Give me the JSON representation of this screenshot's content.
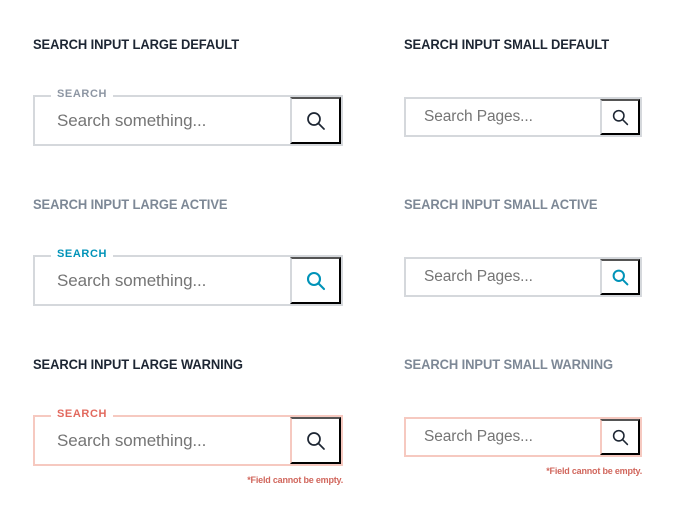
{
  "theme": {
    "background": "#ffffff",
    "heading_color": "#1d2633",
    "heading_muted_color": "#7d8896",
    "border_default": "#d5d8dc",
    "border_warning": "#f6c9c0",
    "placeholder_color": "#c6cad0",
    "accent_active": "#0093b8",
    "accent_warning": "#e2695e",
    "error_text_color": "#d1675d",
    "icon_default_color": "#1d2633"
  },
  "icons": {
    "search": "search-icon"
  },
  "variants": [
    {
      "id": "large-default",
      "heading": "SEARCH INPUT LARGE DEFAULT",
      "heading_style": "dark",
      "size": "large",
      "state": "default",
      "label": "SEARCH",
      "has_label": true,
      "placeholder": "Search something...",
      "value": "",
      "icon": "search-icon",
      "error": "",
      "has_error": false
    },
    {
      "id": "small-default",
      "heading": "SEARCH INPUT SMALL DEFAULT",
      "heading_style": "dark",
      "size": "small",
      "state": "default",
      "label": "",
      "has_label": false,
      "placeholder": "Search Pages...",
      "value": "",
      "icon": "search-icon",
      "error": "",
      "has_error": false
    },
    {
      "id": "large-active",
      "heading": "SEARCH INPUT LARGE ACTIVE",
      "heading_style": "muted",
      "size": "large",
      "state": "active",
      "label": "SEARCH",
      "has_label": true,
      "placeholder": "Search something...",
      "value": "",
      "icon": "search-icon",
      "error": "",
      "has_error": false
    },
    {
      "id": "small-active",
      "heading": "SEARCH INPUT SMALL ACTIVE",
      "heading_style": "muted",
      "size": "small",
      "state": "active",
      "label": "",
      "has_label": false,
      "placeholder": "Search Pages...",
      "value": "",
      "icon": "search-icon",
      "error": "",
      "has_error": false
    },
    {
      "id": "large-warning",
      "heading": "SEARCH INPUT LARGE WARNING",
      "heading_style": "dark",
      "size": "large",
      "state": "warning",
      "label": "SEARCH",
      "has_label": true,
      "placeholder": "Search something...",
      "value": "",
      "icon": "search-icon",
      "error": "*Field cannot be empty.",
      "has_error": true
    },
    {
      "id": "small-warning",
      "heading": "SEARCH INPUT SMALL WARNING",
      "heading_style": "muted",
      "size": "small",
      "state": "warning",
      "label": "",
      "has_label": false,
      "placeholder": "Search Pages...",
      "value": "",
      "icon": "search-icon",
      "error": "*Field cannot be empty.",
      "has_error": true
    }
  ]
}
